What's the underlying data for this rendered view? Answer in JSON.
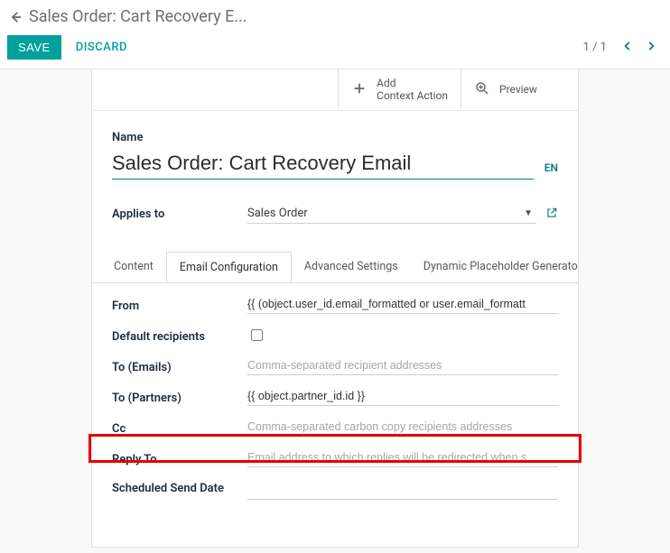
{
  "breadcrumb": {
    "title": "Sales Order: Cart Recovery E..."
  },
  "controls": {
    "save": "SAVE",
    "discard": "DISCARD",
    "pager": "1 / 1"
  },
  "statButtons": {
    "addLine1": "Add",
    "addLine2": "Context Action",
    "preview": "Preview"
  },
  "form": {
    "nameLabel": "Name",
    "nameValue": "Sales Order: Cart Recovery Email",
    "lang": "EN",
    "appliesToLabel": "Applies to",
    "appliesToValue": "Sales Order"
  },
  "tabs": {
    "content": "Content",
    "emailConfig": "Email Configuration",
    "advanced": "Advanced Settings",
    "dynamic": "Dynamic Placeholder Generator"
  },
  "fields": {
    "fromLabel": "From",
    "fromValue": "{{ (object.user_id.email_formatted or user.email_formatt",
    "defaultRecipientsLabel": "Default recipients",
    "toEmailsLabel": "To (Emails)",
    "toEmailsPlaceholder": "Comma-separated recipient addresses",
    "toPartnersLabel": "To (Partners)",
    "toPartnersValue": "{{ object.partner_id.id }}",
    "ccLabel": "Cc",
    "ccPlaceholder": "Comma-separated carbon copy recipients addresses",
    "replyToLabel": "Reply To",
    "replyToPlaceholder": "Email address to which replies will be redirected when s",
    "scheduledLabel": "Scheduled Send Date"
  }
}
